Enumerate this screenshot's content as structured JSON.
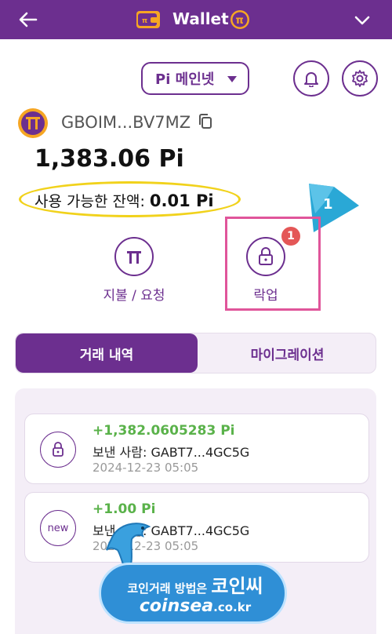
{
  "header": {
    "title": "Wallet"
  },
  "network": {
    "selected": "Pi 메인넷"
  },
  "account": {
    "address": "GBOIM...BV7MZ",
    "balance": "1,383.06 Pi",
    "available_label": "사용 가능한 잔액: ",
    "available_value": "0.01 Pi"
  },
  "annotation": {
    "number": "1",
    "color": "#2aa8d6"
  },
  "actions": {
    "pay_label": "지불 / 요청",
    "lock_label": "락업",
    "lock_badge": "1"
  },
  "tabs": [
    {
      "label": "거래 내역",
      "active": true
    },
    {
      "label": "마이그레이션",
      "active": false
    }
  ],
  "transactions": [
    {
      "icon": "lock-icon",
      "amount": "+1,382.0605283 Pi",
      "sender": "보낸 사람: GABT7...4GC5G",
      "date": "2024-12-23 05:05"
    },
    {
      "icon": "new",
      "amount": "+1.00 Pi",
      "sender": "보낸 사람: GABT7...4GC5G",
      "date": "2024-12-23 05:05"
    }
  ],
  "watermark": {
    "line1_small": "코인거래 방법은 ",
    "line1_big": "코인씨",
    "line2_big": "coinsea",
    "line2_small": ".co.kr"
  },
  "colors": {
    "brand": "#6c2f8f",
    "positive": "#5ab24a",
    "highlight_oval": "#f1d21b",
    "highlight_box": "#e0559a",
    "badge": "#e45757"
  }
}
